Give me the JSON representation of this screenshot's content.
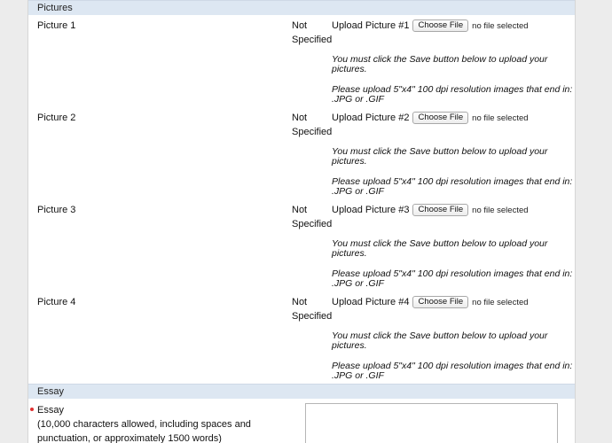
{
  "pictures_section": {
    "title": "Pictures",
    "rows": [
      {
        "label": "Picture 1",
        "status": "Not Specified",
        "upload_label": "Upload Picture #1",
        "button_label": "Choose File",
        "file_status": "no file selected",
        "note_save": "You must click the Save button below to upload your pictures.",
        "note_format": "Please upload 5\"x4\" 100 dpi resolution images that end in: .JPG or .GIF"
      },
      {
        "label": "Picture 2",
        "status": "Not Specified",
        "upload_label": "Upload Picture #2",
        "button_label": "Choose File",
        "file_status": "no file selected",
        "note_save": "You must click the Save button below to upload your pictures.",
        "note_format": "Please upload 5\"x4\" 100 dpi resolution images that end in: .JPG or .GIF"
      },
      {
        "label": "Picture 3",
        "status": "Not Specified",
        "upload_label": "Upload Picture #3",
        "button_label": "Choose File",
        "file_status": "no file selected",
        "note_save": "You must click the Save button below to upload your pictures.",
        "note_format": "Please upload 5\"x4\" 100 dpi resolution images that end in: .JPG or .GIF"
      },
      {
        "label": "Picture 4",
        "status": "Not Specified",
        "upload_label": "Upload Picture #4",
        "button_label": "Choose File",
        "file_status": "no file selected",
        "note_save": "You must click the Save button below to upload your pictures.",
        "note_format": "Please upload 5\"x4\" 100 dpi resolution images that end in: .JPG or .GIF"
      }
    ]
  },
  "essay_section": {
    "title": "Essay",
    "label": "Essay",
    "help": "(10,000 characters allowed, including spaces and punctuation, or approximately 1500 words)",
    "value": ""
  },
  "colors": {
    "section_header_bg": "#dde7f2",
    "required_marker": "#e03131"
  }
}
